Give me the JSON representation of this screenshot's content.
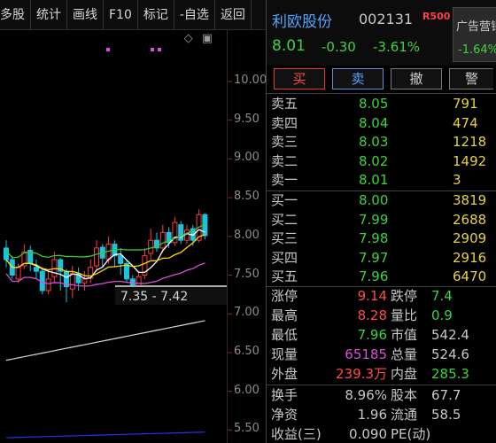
{
  "toolbar": {
    "items": [
      "多股",
      "统计",
      "画线",
      "F10",
      "标记",
      "-自选",
      "返回"
    ]
  },
  "chart": {
    "price_ticks": [
      "10.00",
      "9.50",
      "9.00",
      "8.50",
      "8.00",
      "7.50",
      "7.00",
      "6.50",
      "6.00",
      "5.50"
    ],
    "range_label": "7.35 - 7.42",
    "icons": [
      "diamond-icon",
      "expand-icon"
    ],
    "colors": {
      "up": "#ff3b3b",
      "down": "#19c4e0",
      "ma5": "#ffffff",
      "ma10": "#ffd700",
      "ma20": "#d94fd9",
      "ma60": "#33cc33",
      "long_ma": "#d8d8d8",
      "bottom_line": "#2233ee"
    }
  },
  "quote": {
    "name": "利欧股份",
    "code": "002131",
    "r_tag": "R500",
    "price": "8.01",
    "change": "-0.30",
    "change_pct": "-3.61%",
    "ad": {
      "title": "广告营销",
      "value": "-1.64%"
    },
    "buttons": [
      "买",
      "卖",
      "撤",
      "警"
    ],
    "asks": [
      {
        "label": "卖五",
        "price": "8.05",
        "vol": "791"
      },
      {
        "label": "卖四",
        "price": "8.04",
        "vol": "474"
      },
      {
        "label": "卖三",
        "price": "8.03",
        "vol": "1218"
      },
      {
        "label": "卖二",
        "price": "8.02",
        "vol": "1492"
      },
      {
        "label": "卖一",
        "price": "8.01",
        "vol": "3"
      }
    ],
    "bids": [
      {
        "label": "买一",
        "price": "8.00",
        "vol": "3819"
      },
      {
        "label": "买二",
        "price": "7.99",
        "vol": "2688"
      },
      {
        "label": "买三",
        "price": "7.98",
        "vol": "2909"
      },
      {
        "label": "买四",
        "price": "7.97",
        "vol": "2916"
      },
      {
        "label": "买五",
        "price": "7.96",
        "vol": "6470"
      }
    ],
    "stats1": [
      {
        "l1": "涨停",
        "v1": "9.14",
        "c1": "red",
        "l2": "跌停",
        "v2": "7.4",
        "c2": "green"
      },
      {
        "l1": "最高",
        "v1": "8.28",
        "c1": "red",
        "l2": "量比",
        "v2": "0.9",
        "c2": "green"
      },
      {
        "l1": "最低",
        "v1": "7.96",
        "c1": "green",
        "l2": "市值",
        "v2": "542.4",
        "c2": "wht"
      },
      {
        "l1": "现量",
        "v1": "65185",
        "c1": "mag",
        "l2": "总量",
        "v2": "524.6",
        "c2": "wht"
      },
      {
        "l1": "外盘",
        "v1": "239.3万",
        "c1": "red",
        "l2": "内盘",
        "v2": "285.3",
        "c2": "green"
      }
    ],
    "stats2": [
      {
        "l1": "换手",
        "v1": "8.96%",
        "c1": "wht",
        "l2": "股本",
        "v2": "67.7",
        "c2": "wht"
      },
      {
        "l1": "净资",
        "v1": "1.96",
        "c1": "wht",
        "l2": "流通",
        "v2": "58.5",
        "c2": "wht"
      },
      {
        "l1": "收益(三)",
        "v1": "0.090",
        "c1": "wht",
        "l2": "PE(动)",
        "v2": "",
        "c2": "wht"
      }
    ]
  }
}
